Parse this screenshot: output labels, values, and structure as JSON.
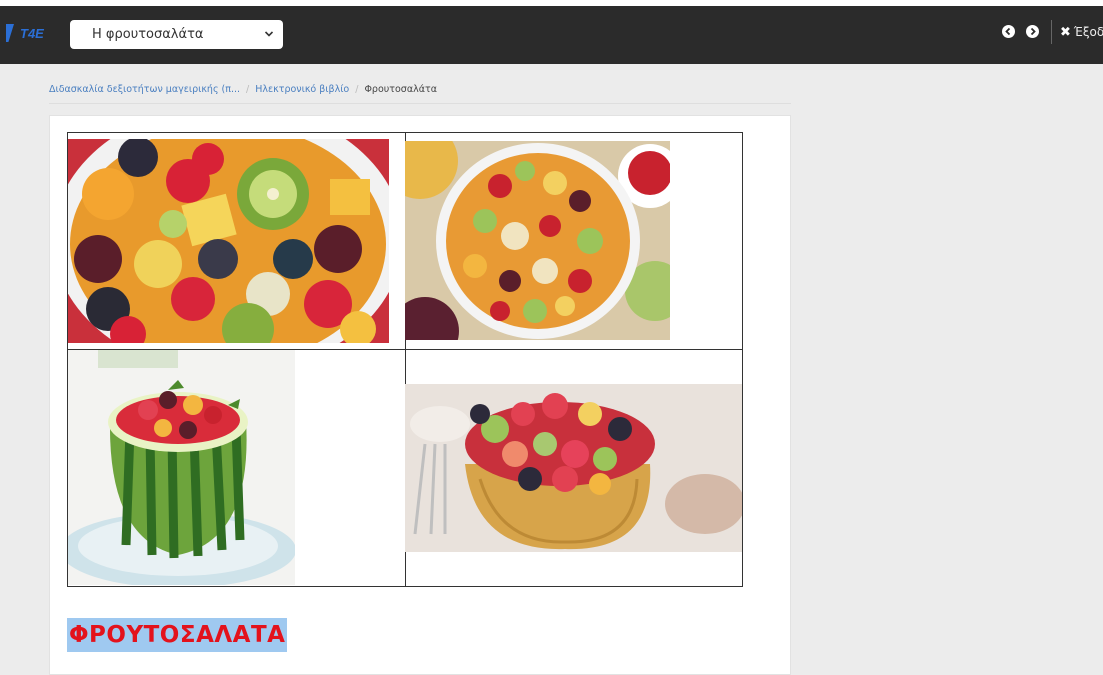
{
  "header": {
    "logo_text": "T4E",
    "select_value": "Η φρουτοσαλάτα",
    "exit_label": "Έξοδ"
  },
  "breadcrumb": {
    "items": [
      "Διδασκαλία δεξιοτήτων μαγειρικής (π...",
      "Ηλεκτρονικό βιβλίο",
      "Φρουτοσαλάτα"
    ]
  },
  "content": {
    "heading": "ΦΡΟΥΤΟΣΑΛΑΤΑ"
  },
  "colors": {
    "topbar": "#2b2b2b",
    "link": "#4a7fc0",
    "heading_text": "#e3121c",
    "heading_highlight": "#9fc9f0"
  }
}
